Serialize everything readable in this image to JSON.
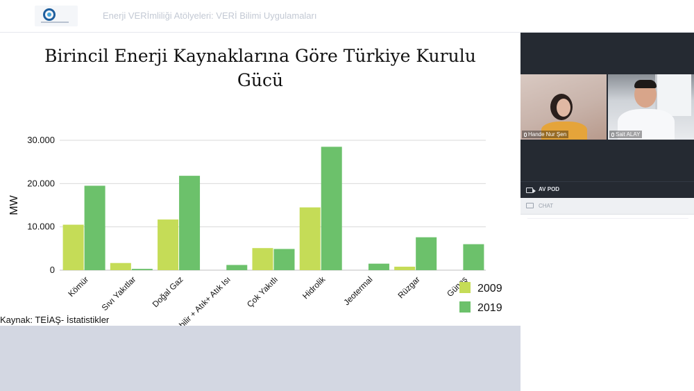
{
  "header": {
    "app_title": "Enerji VERİmliliği Atölyeleri: VERİ Bilimi Uygulamaları"
  },
  "slide": {
    "source_note": "Kaynak: TEİAŞ- İstatistikler"
  },
  "chart_data": {
    "type": "bar",
    "title": "Birincil Enerji Kaynaklarına Göre Türkiye Kurulu Gücü",
    "title_lines": [
      "Birincil Enerji Kaynaklarına Göre Türkiye Kurulu",
      "Gücü"
    ],
    "xlabel": "",
    "ylabel": "MW",
    "ylim": [
      0,
      30000
    ],
    "yticks": [
      0,
      10000,
      20000,
      30000
    ],
    "ytick_labels": [
      "0",
      "10.000",
      "20.000",
      "30.000"
    ],
    "grid": true,
    "legend": "bottom-right",
    "categories": [
      "Kömür",
      "Sıvı Yakıtlar",
      "Doğal Gaz",
      "Yenilenebilir + Atık+ Atık Isı",
      "Çok Yakıtlı",
      "Hidrolik",
      "Jeotermal",
      "Rüzgar",
      "Güneş"
    ],
    "series": [
      {
        "name": "2009",
        "color": "#c5dc57",
        "values": [
          10500,
          1650,
          11700,
          0,
          5100,
          14500,
          0,
          800,
          0
        ]
      },
      {
        "name": "2019",
        "color": "#6cc16b",
        "values": [
          19500,
          300,
          21800,
          1200,
          4900,
          28500,
          1500,
          7600,
          6000
        ]
      }
    ]
  },
  "side_panel": {
    "participants": [
      {
        "name": "Hande Nur Şen"
      },
      {
        "name": "Sait ALAY"
      }
    ],
    "av_pod_label": "AV POD",
    "chat_label": "CHAT",
    "icons": [
      "camera-icon",
      "chat-icon",
      "mic-icon"
    ]
  }
}
